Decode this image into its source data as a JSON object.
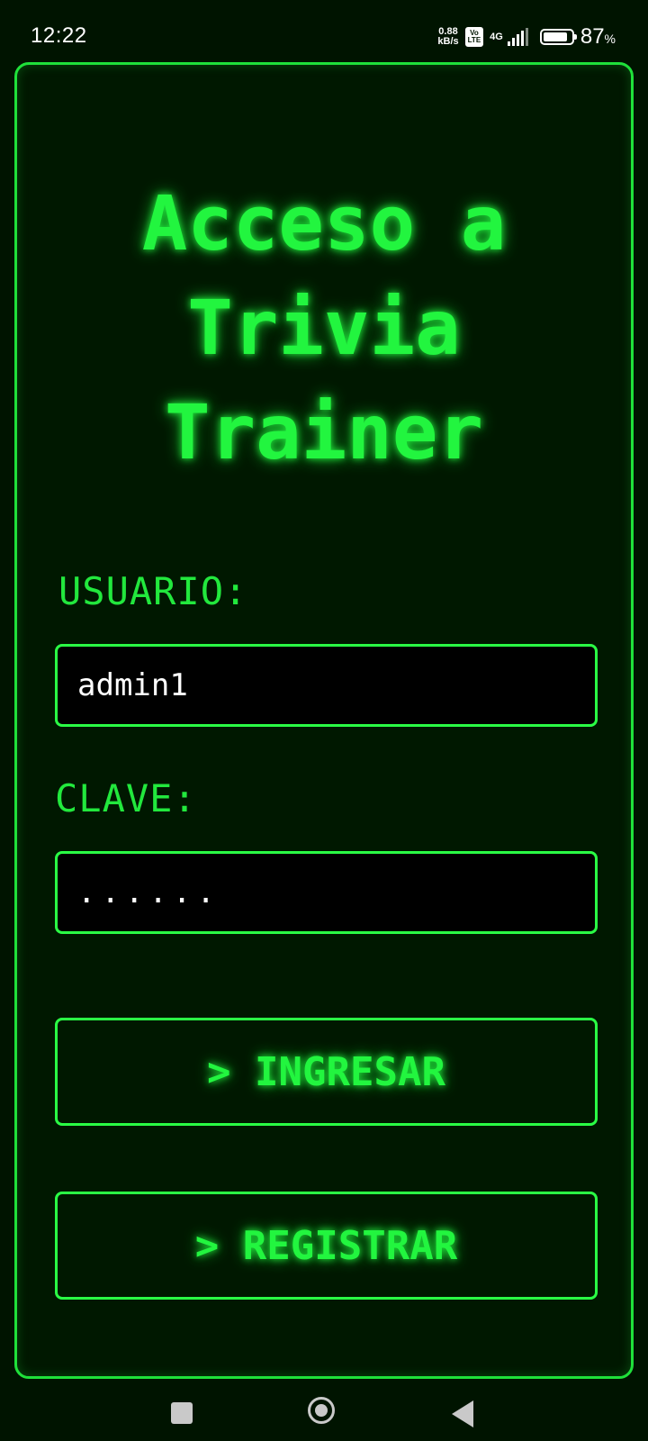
{
  "status_bar": {
    "time": "12:22",
    "speed_value": "0.88",
    "speed_unit": "kB/s",
    "volte_top": "Vo",
    "volte_bottom": "LTE",
    "network": "4G",
    "battery_percent": "87",
    "battery_unit": "%",
    "battery_level": 0.87
  },
  "login": {
    "title_lines": [
      "Acceso a",
      "Trivia",
      "Trainer"
    ],
    "user_label": "USUARIO:",
    "user_value": "admin1",
    "pass_label": "CLAVE:",
    "pass_value": "......",
    "login_button": "> INGRESAR",
    "register_button": "> REGISTRAR"
  },
  "colors": {
    "background": "#001400",
    "accent": "#22f53f",
    "field_bg": "#000000",
    "text": "#ffffff"
  },
  "icons": {
    "nav_recents": "square-icon",
    "nav_home": "circle-home-icon",
    "nav_back": "triangle-back-icon"
  }
}
